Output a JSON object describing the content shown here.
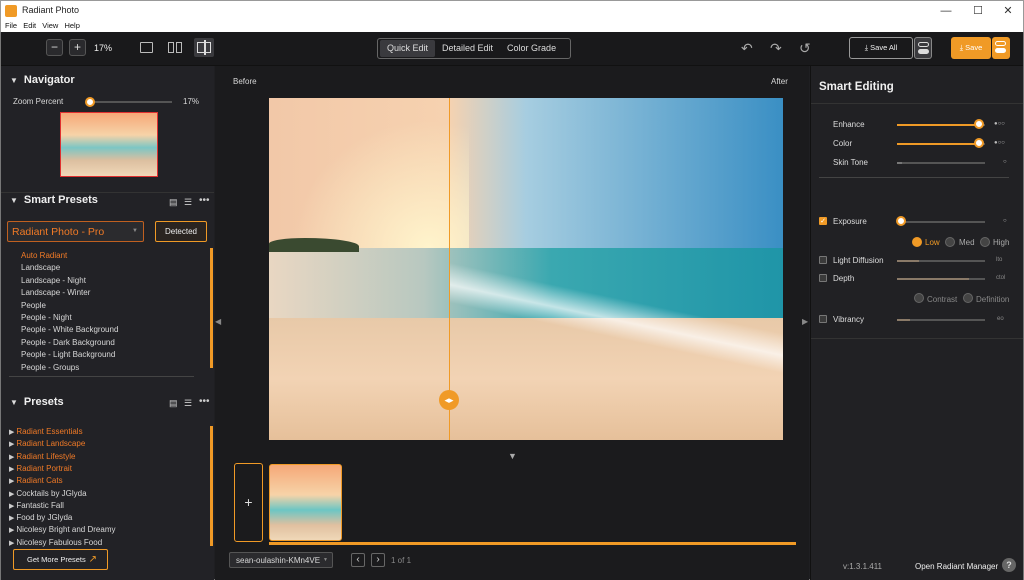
{
  "window": {
    "title": "Radiant Photo",
    "minimize": "—",
    "maximize": "☐",
    "close": "✕"
  },
  "menu": [
    "File",
    "Edit",
    "View",
    "Help"
  ],
  "toolbar": {
    "zoom_out": "−",
    "zoom_in": "+",
    "zoom": "17%",
    "modes": [
      "Quick Edit",
      "Detailed Edit",
      "Color Grade"
    ],
    "save_all": "Save All",
    "save": "Save",
    "undo": "↶",
    "redo": "↷",
    "reset": "↺"
  },
  "navigator": {
    "title": "Navigator",
    "zoom_label": "Zoom Percent",
    "zoom_value": "17%",
    "zoom_fraction": 0.0
  },
  "smart_presets": {
    "title": "Smart Presets",
    "selected": "Radiant Photo - Pro",
    "detected": "Detected",
    "items": [
      "Auto Radiant",
      "Landscape",
      "Landscape - Night",
      "Landscape - Winter",
      "People",
      "People - Night",
      "People - White Background",
      "People - Dark Background",
      "People - Light Background",
      "People - Groups"
    ]
  },
  "presets": {
    "title": "Presets",
    "items": [
      "Radiant Essentials",
      "Radiant Landscape",
      "Radiant Lifestyle",
      "Radiant Portrait",
      "Radiant Cats",
      "Cocktails by JGlyda",
      "Fantastic Fall",
      "Food by JGlyda",
      "Nicolesy Bright and Dreamy",
      "Nicolesy Fabulous Food"
    ],
    "get_more": "Get More Presets"
  },
  "canvas": {
    "before": "Before",
    "after": "After"
  },
  "filmstrip": {
    "add": "+",
    "filename": "sean-oulashin-KMn4VE",
    "page_text": "1 of 1",
    "prev": "‹",
    "next": "›"
  },
  "smart_editing": {
    "title": "Smart Editing",
    "sliders": [
      {
        "label": "Enhance",
        "value": 1.0,
        "icon": "●○○"
      },
      {
        "label": "Color",
        "value": 1.0,
        "icon": "●○○"
      },
      {
        "label": "Skin Tone",
        "value": 0.0,
        "icon": "○"
      }
    ],
    "exposure": {
      "label": "Exposure",
      "value": 0.0,
      "icon": "○",
      "checked": true,
      "options": [
        "Low",
        "Med",
        "High"
      ]
    },
    "light_diffusion": {
      "label": "Light Diffusion",
      "value": 0.3,
      "icon": "lto"
    },
    "depth": {
      "label": "Depth",
      "value": 0.8,
      "icon": "ctol",
      "options": [
        "Contrast",
        "Definition"
      ]
    },
    "vibrancy": {
      "label": "Vibrancy",
      "value": 0.2,
      "icon": "eo"
    }
  },
  "footer": {
    "version": "v:1.3.1.411",
    "manager": "Open Radiant Manager",
    "help": "?"
  },
  "colors": {
    "accent": "#f09a26",
    "accent_text": "#f07a26",
    "bg": "#1f1f22"
  }
}
